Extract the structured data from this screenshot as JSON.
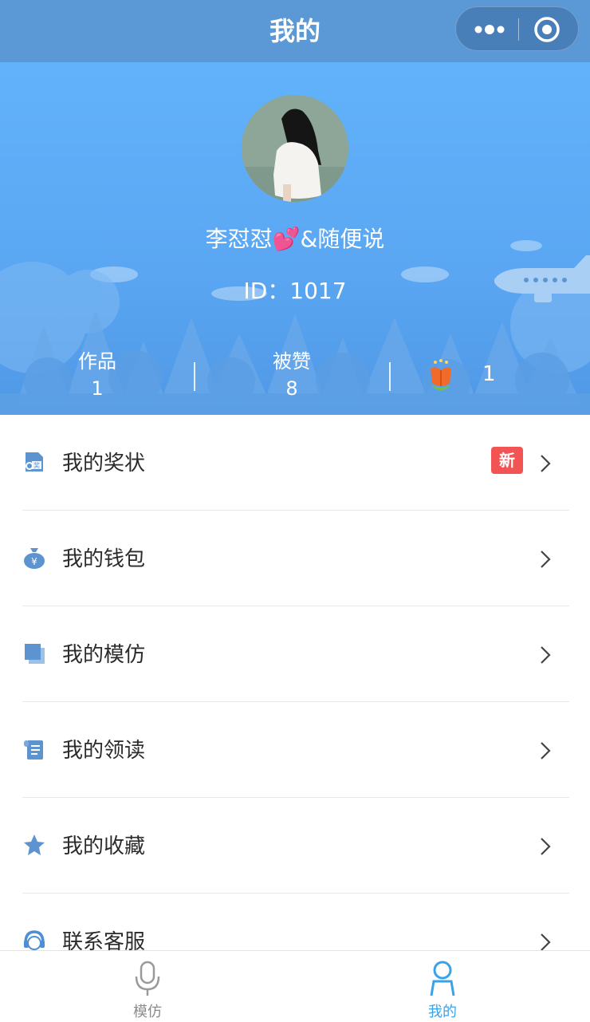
{
  "topbar": {
    "title": "我的"
  },
  "profile": {
    "nickname": "李怼怼💕&随便说",
    "id_text": "ID：1017"
  },
  "stats": [
    {
      "label": "作品",
      "value": "1"
    },
    {
      "label": "被赞",
      "value": "8"
    },
    {
      "icon": "flower-icon",
      "value": "1"
    }
  ],
  "menu": [
    {
      "label": "我的奖状",
      "icon": "certificate-icon",
      "badge": "新"
    },
    {
      "label": "我的钱包",
      "icon": "money-bag-icon"
    },
    {
      "label": "我的模仿",
      "icon": "copy-icon"
    },
    {
      "label": "我的领读",
      "icon": "scroll-icon"
    },
    {
      "label": "我的收藏",
      "icon": "star-icon"
    },
    {
      "label": "联系客服",
      "icon": "headset-icon"
    }
  ],
  "tabbar": {
    "tabs": [
      {
        "label": "模仿",
        "icon": "microphone-icon",
        "active": false
      },
      {
        "label": "我的",
        "icon": "user-icon",
        "active": true
      }
    ],
    "active_color": "#3aa2e8",
    "inactive_color": "#8a8a8a"
  },
  "colors": {
    "accent": "#5b99d6",
    "icon_blue": "#4f8fd0",
    "badge_red": "#f25353"
  }
}
